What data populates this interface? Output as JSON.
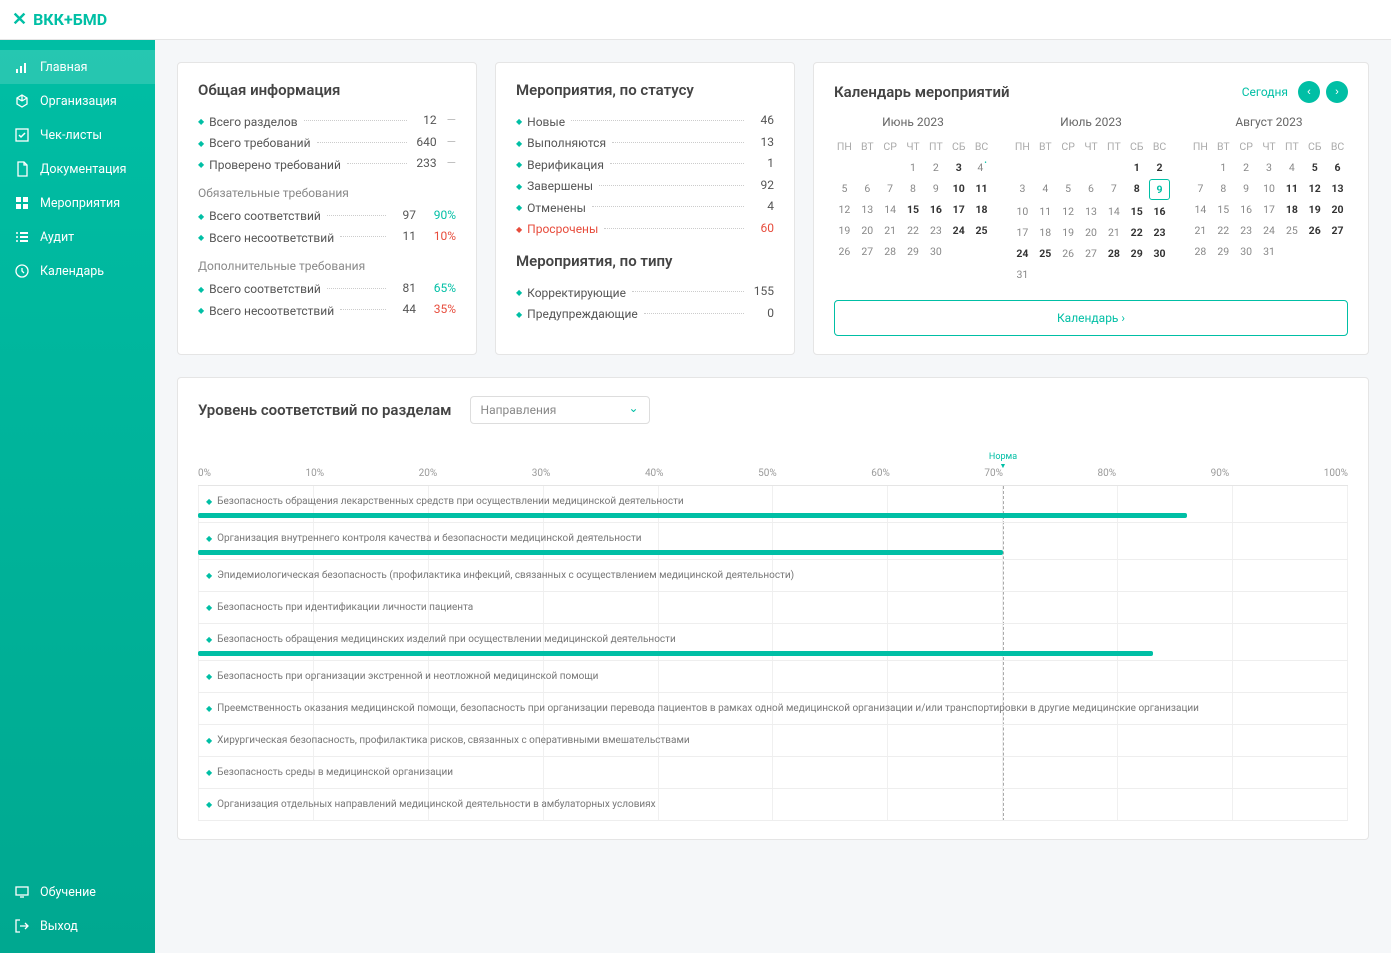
{
  "header": {
    "logo_text": "ВКК+БМD"
  },
  "sidebar": {
    "items": [
      {
        "label": "Главная",
        "icon": "bars"
      },
      {
        "label": "Организация",
        "icon": "org"
      },
      {
        "label": "Чек-листы",
        "icon": "check"
      },
      {
        "label": "Документация",
        "icon": "doc"
      },
      {
        "label": "Мероприятия",
        "icon": "grid"
      },
      {
        "label": "Аудит",
        "icon": "list"
      },
      {
        "label": "Календарь",
        "icon": "clock"
      }
    ],
    "bottom": [
      {
        "label": "Обучение",
        "icon": "tv"
      },
      {
        "label": "Выход",
        "icon": "exit"
      }
    ]
  },
  "info": {
    "title": "Общая информация",
    "rows": [
      {
        "label": "Всего разделов",
        "val": "12",
        "extra": "dash"
      },
      {
        "label": "Всего требований",
        "val": "640",
        "extra": "dash"
      },
      {
        "label": "Проверено требований",
        "val": "233",
        "extra": "dash"
      }
    ],
    "sub1_title": "Обязательные требования",
    "sub1_rows": [
      {
        "label": "Всего соответствий",
        "val": "97",
        "pct": "90%",
        "cls": "green"
      },
      {
        "label": "Всего несоответствий",
        "val": "11",
        "pct": "10%",
        "cls": "red"
      }
    ],
    "sub2_title": "Дополнительные требования",
    "sub2_rows": [
      {
        "label": "Всего соответствий",
        "val": "81",
        "pct": "65%",
        "cls": "green"
      },
      {
        "label": "Всего несоответствий",
        "val": "44",
        "pct": "35%",
        "cls": "red"
      }
    ]
  },
  "events_status": {
    "title": "Мероприятия, по статусу",
    "rows": [
      {
        "label": "Новые",
        "val": "46"
      },
      {
        "label": "Выполняются",
        "val": "13"
      },
      {
        "label": "Верификация",
        "val": "1"
      },
      {
        "label": "Завершены",
        "val": "92"
      },
      {
        "label": "Отменены",
        "val": "4"
      },
      {
        "label": "Просрочены",
        "val": "60",
        "red": true
      }
    ]
  },
  "events_type": {
    "title": "Мероприятия, по типу",
    "rows": [
      {
        "label": "Корректирующие",
        "val": "155"
      },
      {
        "label": "Предупреждающие",
        "val": "0"
      }
    ]
  },
  "calendar": {
    "title": "Календарь мероприятий",
    "today": "Сегодня",
    "link": "Календарь ›",
    "dow": [
      "ПН",
      "ВТ",
      "СР",
      "ЧТ",
      "ПТ",
      "СБ",
      "ВС"
    ],
    "months": [
      {
        "name": "Июнь 2023",
        "start": 3,
        "days": 30,
        "bold": [
          3,
          10,
          11,
          15,
          16,
          17,
          18,
          24,
          25
        ],
        "dot": [
          4
        ]
      },
      {
        "name": "Июль 2023",
        "start": 5,
        "days": 31,
        "bold": [
          1,
          2,
          8,
          9,
          15,
          16,
          22,
          23,
          24,
          25,
          28,
          29,
          30
        ],
        "today": 9
      },
      {
        "name": "Август 2023",
        "start": 1,
        "days": 31,
        "bold": [
          5,
          6,
          11,
          12,
          13,
          18,
          19,
          20,
          26,
          27
        ]
      }
    ]
  },
  "chart_data": {
    "type": "bar",
    "title": "Уровень соответствий по разделам",
    "select_label": "Направления",
    "norm_label": "Норма",
    "norm_value": 70,
    "xlabel": "",
    "ylabel": "",
    "xlim": [
      0,
      100
    ],
    "ticks": [
      "0%",
      "10%",
      "20%",
      "30%",
      "40%",
      "50%",
      "60%",
      "70%",
      "80%",
      "90%",
      "100%"
    ],
    "categories": [
      "Безопасность обращения лекарственных средств при осуществлении медицинской деятельности",
      "Организация внутреннего контроля качества и безопасности медицинской деятельности",
      "Эпидемиологическая безопасность (профилактика инфекций, связанных с осуществлением медицинской деятельности)",
      "Безопасность при идентификации личности пациента",
      "Безопасность обращения медицинских изделий при осуществлении медицинской деятельности",
      "Безопасность при организации экстренной и неотложной медицинской помощи",
      "Преемственность оказания медицинской помощи, безопасность при организации перевода пациентов в рамках одной медицинской организации и/или транспортировки в другие медицинские организации",
      "Хирургическая безопасность, профилактика рисков, связанных с оперативными вмешательствами",
      "Безопасность среды в медицинской организации",
      "Организация отдельных направлений медицинской деятельности в амбулаторных условиях"
    ],
    "values": [
      86,
      70,
      0,
      0,
      83,
      0,
      0,
      0,
      0,
      0
    ]
  }
}
